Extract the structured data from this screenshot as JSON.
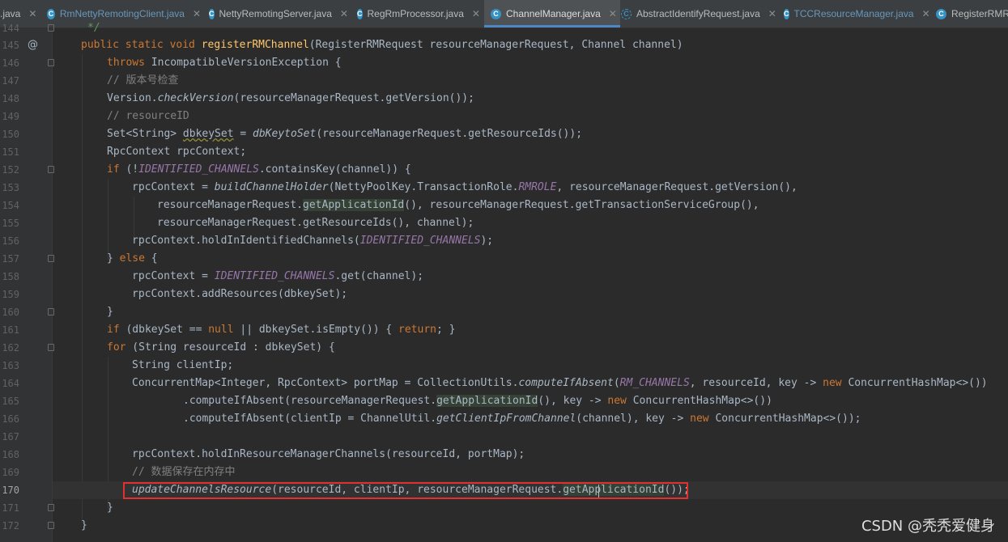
{
  "tabs": [
    {
      "label": ".java"
    },
    {
      "label": "RmNettyRemotingClient.java"
    },
    {
      "label": "NettyRemotingServer.java"
    },
    {
      "label": "RegRmProcessor.java"
    },
    {
      "label": "ChannelManager.java"
    },
    {
      "label": "AbstractIdentifyRequest.java"
    },
    {
      "label": "TCCResourceManager.java"
    },
    {
      "label": "RegisterRMRe"
    }
  ],
  "active_tab": "ChannelManager.java",
  "line_numbers": [
    "144",
    "145",
    "146",
    "147",
    "148",
    "149",
    "150",
    "151",
    "152",
    "153",
    "154",
    "155",
    "156",
    "157",
    "158",
    "159",
    "160",
    "161",
    "162",
    "163",
    "164",
    "165",
    "166",
    "167",
    "168",
    "169",
    "170",
    "171",
    "172"
  ],
  "gutter": {
    "override_marker": "@"
  },
  "code": {
    "l144": "*/",
    "l145": [
      "public static void ",
      "registerRMChannel",
      "(RegisterRMRequest resourceManagerRequest, Channel channel)"
    ],
    "l146": [
      "throws",
      " IncompatibleVersionException {"
    ],
    "l147": "// 版本号检查",
    "l148": [
      "Version.",
      "checkVersion",
      "(resourceManagerRequest.getVersion());"
    ],
    "l149": "// resourceID",
    "l150": [
      "Set<String> ",
      "dbkeySet",
      " = ",
      "dbKeytoSet",
      "(resourceManagerRequest.getResourceIds());"
    ],
    "l151": "RpcContext rpcContext;",
    "l152": [
      "if",
      " (!",
      "IDENTIFIED_CHANNELS",
      ".containsKey(channel)) {"
    ],
    "l153": [
      "rpcContext = ",
      "buildChannelHolder",
      "(NettyPoolKey.TransactionRole.",
      "RMROLE",
      ", resourceManagerRequest.getVersion(),"
    ],
    "l154": [
      "resourceManagerRequest.",
      "getApplicationId",
      "(), resourceManagerRequest.getTransactionServiceGroup(),"
    ],
    "l155": "resourceManagerRequest.getResourceIds(), channel);",
    "l156": [
      "rpcContext.holdInIdentifiedChannels(",
      "IDENTIFIED_CHANNELS",
      ");"
    ],
    "l157": [
      "} ",
      "else",
      " {"
    ],
    "l158": [
      "rpcContext = ",
      "IDENTIFIED_CHANNELS",
      ".get(channel);"
    ],
    "l159": "rpcContext.addResources(dbkeySet);",
    "l160": "}",
    "l161": [
      "if",
      " (dbkeySet == ",
      "null",
      " || dbkeySet.isEmpty()) { ",
      "return",
      "; }"
    ],
    "l162": [
      "for",
      " (String resourceId : dbkeySet) {"
    ],
    "l163": "String clientIp;",
    "l164": [
      "ConcurrentMap<Integer, RpcContext> portMap = CollectionUtils.",
      "computeIfAbsent",
      "(",
      "RM_CHANNELS",
      ", resourceId, key -> ",
      "new",
      " ConcurrentHashMap<>())"
    ],
    "l165": [
      ".computeIfAbsent(resourceManagerRequest.",
      "getApplicationId",
      "(), key -> ",
      "new",
      " ConcurrentHashMap<>())"
    ],
    "l166": [
      ".computeIfAbsent(clientIp = ChannelUtil.",
      "getClientIpFromChannel",
      "(channel), key -> ",
      "new",
      " ConcurrentHashMap<>());"
    ],
    "l167": "",
    "l168": "rpcContext.holdInResourceManagerChannels(resourceId, portMap);",
    "l169": "// 数据保存在内存中",
    "l170": [
      "updateChannelsResource",
      "(resourceId, clientIp, resourceManagerRequest.",
      "getApplicationId",
      "());"
    ],
    "l171": "}",
    "l172": "}"
  },
  "current_line": "170",
  "watermark": "CSDN @秃秃爱健身",
  "colors": {
    "background": "#2b2b2b",
    "keyword": "#cc7832",
    "method_declaration": "#ffc66d",
    "static_field": "#9876aa",
    "comment": "#808080",
    "highlight_box": "#e03030"
  }
}
